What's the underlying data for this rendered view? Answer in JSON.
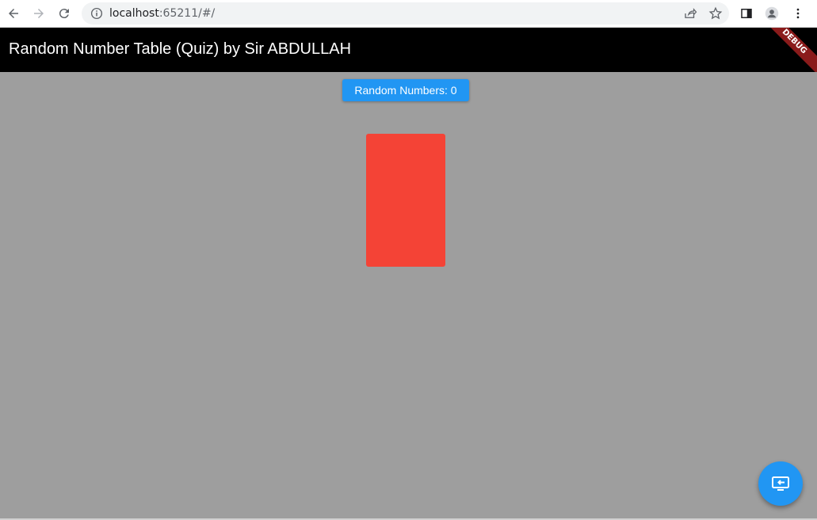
{
  "browser": {
    "url_host": "localhost",
    "url_rest": ":65211/#/"
  },
  "app_bar": {
    "title": "Random Number Table (Quiz) by Sir ABDULLAH",
    "debug_banner": "DEBUG",
    "background": "#000000"
  },
  "content": {
    "random_button_label": "Random Numbers: 0",
    "button_color": "#2196f3",
    "box_color": "#f44336",
    "background": "#9e9e9e"
  },
  "fab": {
    "icon": "screen-share-icon",
    "color": "#2196f3"
  }
}
